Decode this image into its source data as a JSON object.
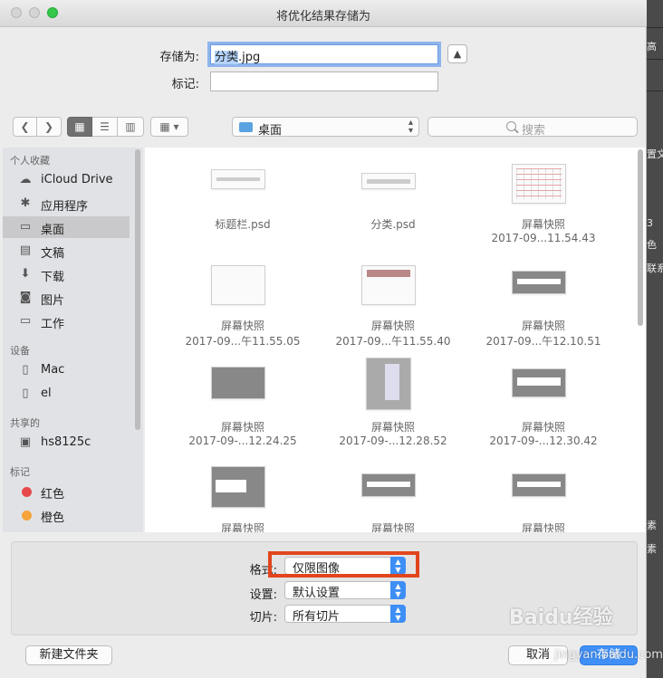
{
  "window": {
    "title": "将优化结果存储为"
  },
  "form": {
    "saveas_label": "存储为:",
    "filename_selected": "分类",
    "filename_ext": ".jpg",
    "tags_label": "标记:",
    "tags_value": ""
  },
  "toolbar": {
    "location": "桌面",
    "search_placeholder": "搜索"
  },
  "sidebar": {
    "sections": [
      {
        "title": "个人收藏",
        "items": [
          {
            "label": "iCloud Drive",
            "icon": "cloud-icon"
          },
          {
            "label": "应用程序",
            "icon": "applications-icon"
          },
          {
            "label": "桌面",
            "icon": "desktop-icon",
            "selected": true
          },
          {
            "label": "文稿",
            "icon": "documents-icon"
          },
          {
            "label": "下载",
            "icon": "downloads-icon"
          },
          {
            "label": "图片",
            "icon": "pictures-icon"
          },
          {
            "label": "工作",
            "icon": "folder-icon"
          }
        ]
      },
      {
        "title": "设备",
        "items": [
          {
            "label": "Mac",
            "icon": "disk-icon"
          },
          {
            "label": "el",
            "icon": "disk-icon"
          }
        ]
      },
      {
        "title": "共享的",
        "items": [
          {
            "label": "hs8125c",
            "icon": "monitor-icon"
          }
        ]
      },
      {
        "title": "标记",
        "items": [
          {
            "label": "红色",
            "color": "#e6484a"
          },
          {
            "label": "橙色",
            "color": "#f5a33a"
          }
        ]
      }
    ]
  },
  "files": [
    {
      "name": "标题栏.psd",
      "date": ""
    },
    {
      "name": "分类.psd",
      "date": ""
    },
    {
      "name": "屏幕快照",
      "date": "2017-09...11.54.43"
    },
    {
      "name": "屏幕快照",
      "date": "2017-09...午11.55.05"
    },
    {
      "name": "屏幕快照",
      "date": "2017-09...午11.55.40"
    },
    {
      "name": "屏幕快照",
      "date": "2017-09...午12.10.51"
    },
    {
      "name": "屏幕快照",
      "date": "2017-09-...12.24.25"
    },
    {
      "name": "屏幕快照",
      "date": "2017-09-...12.28.52"
    },
    {
      "name": "屏幕快照",
      "date": "2017-09-...12.30.42"
    },
    {
      "name": "屏幕快照",
      "date": ""
    },
    {
      "name": "屏幕快照",
      "date": ""
    },
    {
      "name": "屏幕快照",
      "date": ""
    }
  ],
  "options": {
    "format_label": "格式:",
    "format_value": "仅限图像",
    "settings_label": "设置:",
    "settings_value": "默认设置",
    "slices_label": "切片:",
    "slices_value": "所有切片"
  },
  "buttons": {
    "new_folder": "新建文件夹",
    "cancel": "取消",
    "save": "存储"
  },
  "background": {
    "fragments": [
      "高",
      "置文",
      "3",
      "色",
      "联系",
      "素",
      "素"
    ]
  },
  "watermark": {
    "text": "Baidu经验",
    "sub": "jingyan.baidu.com"
  },
  "colors": {
    "accent": "#3f8ff6",
    "highlight": "#e2451d",
    "zoom": "#34c749"
  }
}
